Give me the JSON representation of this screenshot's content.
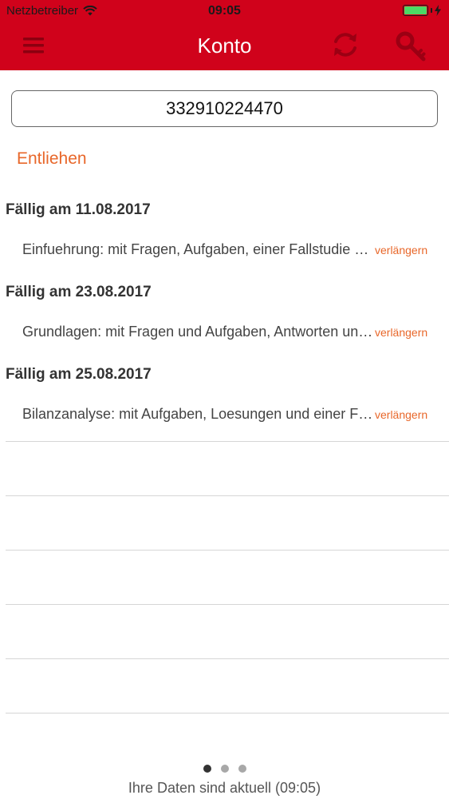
{
  "status_bar": {
    "carrier": "Netzbetreiber",
    "time": "09:05",
    "battery_level": 1.0,
    "battery_color": "#4cd964"
  },
  "nav": {
    "title": "Konto",
    "menu_icon": "hamburger-menu-icon",
    "refresh_icon": "refresh-icon",
    "key_icon": "key-icon",
    "bar_color": "#d0021b"
  },
  "account": {
    "card_number": "332910224470"
  },
  "section": {
    "title": "Entliehen",
    "accent_color": "#e8672a"
  },
  "loans": [
    {
      "due_label": "Fällig am 11.08.2017",
      "title": "Einfuehrung: mit Fragen, Aufgaben, einer Fallstudie und Lösungen",
      "action": "verlängern"
    },
    {
      "due_label": "Fällig am 23.08.2017",
      "title": "Grundlagen: mit Fragen und Aufgaben, Antworten und Lösungen",
      "action": "verlängern"
    },
    {
      "due_label": "Fällig am 25.08.2017",
      "title": "Bilanzanalyse: mit Aufgaben, Loesungen und einer Fallstudie",
      "action": "verlängern"
    }
  ],
  "pager": {
    "pages": 3,
    "active_index": 0
  },
  "footer": {
    "status_text": "Ihre Daten sind aktuell (09:05)"
  }
}
